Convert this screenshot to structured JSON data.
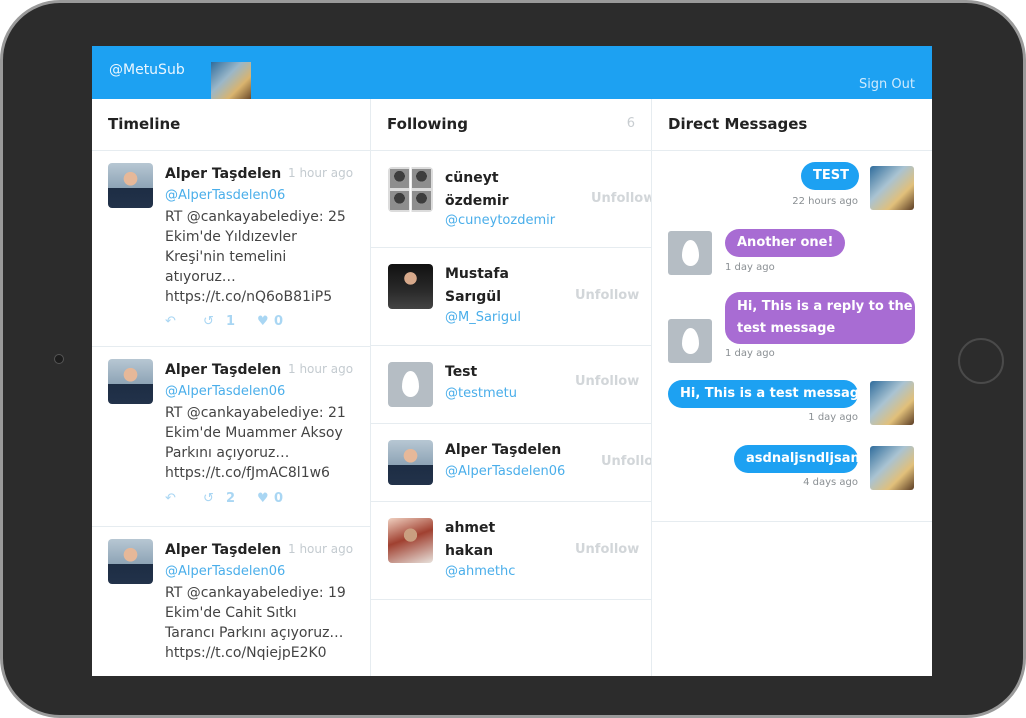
{
  "app": {
    "handle": "@MetuSub",
    "sign_out": "Sign Out"
  },
  "timeline": {
    "title": "Timeline",
    "tweets": [
      {
        "name": "Alper Taşdelen",
        "time": "1 hour ago",
        "handle": "@AlperTasdelen06",
        "lines": [
          "RT @cankayabelediye: 25",
          "Ekim'de Yıldızevler",
          "Kreşi'nin temelini",
          "atıyoruz…",
          "https://t.co/nQ6oB81iP5"
        ],
        "retweets": "1",
        "likes": "0"
      },
      {
        "name": "Alper Taşdelen",
        "time": "1 hour ago",
        "handle": "@AlperTasdelen06",
        "lines": [
          "RT @cankayabelediye: 21",
          "Ekim'de Muammer Aksoy",
          "Parkını açıyoruz…",
          "https://t.co/fJmAC8l1w6"
        ],
        "retweets": "2",
        "likes": "0"
      },
      {
        "name": "Alper Taşdelen",
        "time": "1 hour ago",
        "handle": "@AlperTasdelen06",
        "lines": [
          "RT @cankayabelediye: 19",
          "Ekim'de Cahit Sıtkı",
          "Tarancı Parkını açıyoruz…",
          "https://t.co/NqiejpE2K0"
        ]
      }
    ]
  },
  "following": {
    "title": "Following",
    "count": "6",
    "unfollow_label": "Unfollow",
    "users": [
      {
        "name_lines": [
          "cüneyt",
          "özdemir"
        ],
        "handle": "@cuneytozdemir"
      },
      {
        "name_lines": [
          "Mustafa",
          "Sarıgül"
        ],
        "handle": "@M_Sarigul"
      },
      {
        "name_lines": [
          "Test"
        ],
        "handle": "@testmetu"
      },
      {
        "name_lines": [
          "Alper Taşdelen"
        ],
        "handle": "@AlperTasdelen06"
      },
      {
        "name_lines": [
          "ahmet",
          "hakan"
        ],
        "handle": "@ahmethc"
      }
    ]
  },
  "direct_messages": {
    "title": "Direct Messages",
    "messages": [
      {
        "text": "TEST",
        "time": "22 hours ago",
        "side": "right"
      },
      {
        "text": "Another one!",
        "time": "1 day ago",
        "side": "left"
      },
      {
        "text_lines": [
          "Hi, This is a reply to the",
          "test message"
        ],
        "time": "1 day ago",
        "side": "left"
      },
      {
        "text": "Hi, This is a test message",
        "time": "1 day ago",
        "side": "right"
      },
      {
        "text": "asdnaljsndljsan",
        "time": "4 days ago",
        "side": "right"
      }
    ]
  },
  "colors": {
    "accent": "#1da1f2",
    "bubble_purple": "#a86cd3",
    "bezel": "#2c2c2c"
  },
  "icons": {
    "reply": "reply-icon",
    "retweet": "retweet-icon",
    "like": "heart-icon"
  }
}
